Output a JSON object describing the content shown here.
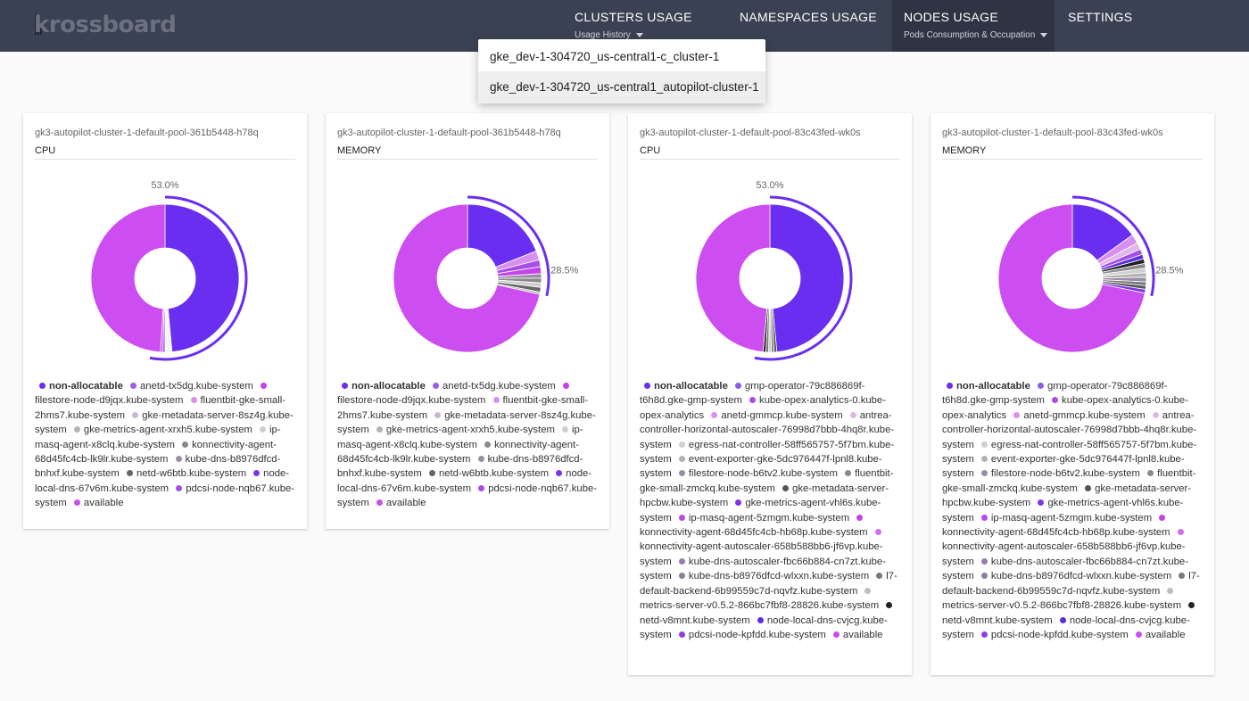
{
  "app": {
    "logo": "krossboard"
  },
  "nav": {
    "clusters": {
      "label": "CLUSTERS USAGE",
      "sub": "Usage History"
    },
    "namespaces": {
      "label": "NAMESPACES USAGE"
    },
    "nodes": {
      "label": "NODES USAGE",
      "sub": "Pods Consumption & Occupation"
    },
    "settings": {
      "label": "SETTINGS"
    }
  },
  "dropdown": {
    "items": [
      "gke_dev-1-304720_us-central1-c_cluster-1",
      "gke_dev-1-304720_us-central1_autopilot-cluster-1"
    ],
    "selected_index": 1
  },
  "colors": {
    "accent": "#6a2ef0",
    "available": "#cc4df0",
    "topbar": "#3a4152"
  },
  "cards": [
    {
      "node": "gk3-autopilot-cluster-1-default-pool-361b5448-h78q",
      "metric": "CPU",
      "usage_label": "53.0%",
      "usage_fraction": 0.53,
      "legend": [
        {
          "label": "non-allocatable",
          "color": "#6a2ef0",
          "bold": true
        },
        {
          "label": "anetd-tx5dg.kube-system",
          "color": "#9b5de5"
        },
        {
          "label": "filestore-node-d9jqx.kube-system",
          "color": "#c542e6"
        },
        {
          "label": "fluentbit-gke-small-2hms7.kube-system",
          "color": "#d88ff0"
        },
        {
          "label": "gke-metadata-server-8sz4g.kube-system",
          "color": "#c9b8d4"
        },
        {
          "label": "gke-metrics-agent-xrxh5.kube-system",
          "color": "#b3b3b3"
        },
        {
          "label": "ip-masq-agent-x8clq.kube-system",
          "color": "#cfcfcf"
        },
        {
          "label": "konnectivity-agent-68d45fc4cb-lk9lr.kube-system",
          "color": "#8a8a8a"
        },
        {
          "label": "kube-dns-b8976dfcd-bnhxf.kube-system",
          "color": "#9a8da6"
        },
        {
          "label": "netd-w6btb.kube-system",
          "color": "#666666"
        },
        {
          "label": "node-local-dns-67v6m.kube-system",
          "color": "#7b36e8"
        },
        {
          "label": "pdcsi-node-nqb67.kube-system",
          "color": "#a64ee8"
        },
        {
          "label": "available",
          "color": "#cc4df0"
        }
      ],
      "slices": [
        {
          "value": 0.485,
          "color": "#6a2ef0"
        },
        {
          "value": 0.015,
          "color": "#f5f5f5"
        },
        {
          "value": 0.005,
          "color": "#9b5de5"
        },
        {
          "value": 0.005,
          "color": "#c542e6"
        },
        {
          "value": 0.49,
          "color": "#cc4df0"
        }
      ]
    },
    {
      "node": "gk3-autopilot-cluster-1-default-pool-361b5448-h78q",
      "metric": "MEMORY",
      "usage_label": "28.5%",
      "usage_fraction": 0.285,
      "legend": [
        {
          "label": "non-allocatable",
          "color": "#6a2ef0",
          "bold": true
        },
        {
          "label": "anetd-tx5dg.kube-system",
          "color": "#9b5de5"
        },
        {
          "label": "filestore-node-d9jqx.kube-system",
          "color": "#c542e6"
        },
        {
          "label": "fluentbit-gke-small-2hms7.kube-system",
          "color": "#d88ff0"
        },
        {
          "label": "gke-metadata-server-8sz4g.kube-system",
          "color": "#c9b8d4"
        },
        {
          "label": "gke-metrics-agent-xrxh5.kube-system",
          "color": "#b3b3b3"
        },
        {
          "label": "ip-masq-agent-x8clq.kube-system",
          "color": "#cfcfcf"
        },
        {
          "label": "konnectivity-agent-68d45fc4cb-lk9lr.kube-system",
          "color": "#8a8a8a"
        },
        {
          "label": "kube-dns-b8976dfcd-bnhxf.kube-system",
          "color": "#9a8da6"
        },
        {
          "label": "netd-w6btb.kube-system",
          "color": "#666666"
        },
        {
          "label": "node-local-dns-67v6m.kube-system",
          "color": "#7b36e8"
        },
        {
          "label": "pdcsi-node-nqb67.kube-system",
          "color": "#a64ee8"
        },
        {
          "label": "available",
          "color": "#cc4df0"
        }
      ],
      "slices": [
        {
          "value": 0.19,
          "color": "#6a2ef0"
        },
        {
          "value": 0.02,
          "color": "#d88ff0"
        },
        {
          "value": 0.015,
          "color": "#a64ee8"
        },
        {
          "value": 0.015,
          "color": "#c542e6"
        },
        {
          "value": 0.01,
          "color": "#9a8da6"
        },
        {
          "value": 0.01,
          "color": "#8a8a8a"
        },
        {
          "value": 0.01,
          "color": "#cfcfcf"
        },
        {
          "value": 0.01,
          "color": "#666666"
        },
        {
          "value": 0.005,
          "color": "#b3b3b3"
        },
        {
          "value": 0.715,
          "color": "#cc4df0"
        }
      ]
    },
    {
      "node": "gk3-autopilot-cluster-1-default-pool-83c43fed-wk0s",
      "metric": "CPU",
      "usage_label": "53.0%",
      "usage_fraction": 0.53,
      "legend": [
        {
          "label": "non-allocatable",
          "color": "#6a2ef0",
          "bold": true
        },
        {
          "label": "gmp-operator-79c886869f-t6h8d.gke-gmp-system",
          "color": "#8a5de8"
        },
        {
          "label": "kube-opex-analytics-0.kube-opex-analytics",
          "color": "#a64ee8"
        },
        {
          "label": "anetd-gmmcp.kube-system",
          "color": "#d88ff0"
        },
        {
          "label": "antrea-controller-horizontal-autoscaler-76998d7bbb-4hq8r.kube-system",
          "color": "#e0b8e8"
        },
        {
          "label": "egress-nat-controller-58ff565757-5f7bm.kube-system",
          "color": "#cfcfcf"
        },
        {
          "label": "event-exporter-gke-5dc976447f-lpnl8.kube-system",
          "color": "#b3b3b3"
        },
        {
          "label": "filestore-node-b6tv2.kube-system",
          "color": "#9a8da6"
        },
        {
          "label": "fluentbit-gke-small-zmckq.kube-system",
          "color": "#8a8a8a"
        },
        {
          "label": "gke-metadata-server-hpcbw.kube-system",
          "color": "#555555"
        },
        {
          "label": "gke-metrics-agent-vhl6s.kube-system",
          "color": "#7b36e8"
        },
        {
          "label": "ip-masq-agent-5zmgm.kube-system",
          "color": "#b24de8"
        },
        {
          "label": "konnectivity-agent-68d45fc4cb-hb68p.kube-system",
          "color": "#c542e6"
        },
        {
          "label": "konnectivity-agent-autoscaler-658b588bb6-jf6vp.kube-system",
          "color": "#d070e8"
        },
        {
          "label": "kube-dns-autoscaler-fbc66b884-cn7zt.kube-system",
          "color": "#9b7ab0"
        },
        {
          "label": "kube-dns-b8976dfcd-wlxxn.kube-system",
          "color": "#8d7f99"
        },
        {
          "label": "l7-default-backend-6b99559c7d-nqvfz.kube-system",
          "color": "#777777"
        },
        {
          "label": "metrics-server-v0.5.2-866bc7fbf8-28826.kube-system",
          "color": "#bdbdbd"
        },
        {
          "label": "netd-v8mnt.kube-system",
          "color": "#222222"
        },
        {
          "label": "node-local-dns-cvjcg.kube-system",
          "color": "#5a2ee0"
        },
        {
          "label": "pdcsi-node-kpfdd.kube-system",
          "color": "#8e3ee8"
        },
        {
          "label": "available",
          "color": "#cc4df0"
        }
      ],
      "slices": [
        {
          "value": 0.485,
          "color": "#6a2ef0"
        },
        {
          "value": 0.006,
          "color": "#555555"
        },
        {
          "value": 0.006,
          "color": "#8a8a8a"
        },
        {
          "value": 0.006,
          "color": "#cfcfcf"
        },
        {
          "value": 0.006,
          "color": "#777777"
        },
        {
          "value": 0.006,
          "color": "#222222"
        },
        {
          "value": 0.485,
          "color": "#cc4df0"
        }
      ]
    },
    {
      "node": "gk3-autopilot-cluster-1-default-pool-83c43fed-wk0s",
      "metric": "MEMORY",
      "usage_label": "28.5%",
      "usage_fraction": 0.285,
      "legend": [
        {
          "label": "non-allocatable",
          "color": "#6a2ef0",
          "bold": true
        },
        {
          "label": "gmp-operator-79c886869f-t6h8d.gke-gmp-system",
          "color": "#8a5de8"
        },
        {
          "label": "kube-opex-analytics-0.kube-opex-analytics",
          "color": "#a64ee8"
        },
        {
          "label": "anetd-gmmcp.kube-system",
          "color": "#d88ff0"
        },
        {
          "label": "antrea-controller-horizontal-autoscaler-76998d7bbb-4hq8r.kube-system",
          "color": "#e0b8e8"
        },
        {
          "label": "egress-nat-controller-58ff565757-5f7bm.kube-system",
          "color": "#cfcfcf"
        },
        {
          "label": "event-exporter-gke-5dc976447f-lpnl8.kube-system",
          "color": "#b3b3b3"
        },
        {
          "label": "filestore-node-b6tv2.kube-system",
          "color": "#9a8da6"
        },
        {
          "label": "fluentbit-gke-small-zmckq.kube-system",
          "color": "#8a8a8a"
        },
        {
          "label": "gke-metadata-server-hpcbw.kube-system",
          "color": "#555555"
        },
        {
          "label": "gke-metrics-agent-vhl6s.kube-system",
          "color": "#7b36e8"
        },
        {
          "label": "ip-masq-agent-5zmgm.kube-system",
          "color": "#b24de8"
        },
        {
          "label": "konnectivity-agent-68d45fc4cb-hb68p.kube-system",
          "color": "#c542e6"
        },
        {
          "label": "konnectivity-agent-autoscaler-658b588bb6-jf6vp.kube-system",
          "color": "#d070e8"
        },
        {
          "label": "kube-dns-autoscaler-fbc66b884-cn7zt.kube-system",
          "color": "#9b7ab0"
        },
        {
          "label": "kube-dns-b8976dfcd-wlxxn.kube-system",
          "color": "#8d7f99"
        },
        {
          "label": "l7-default-backend-6b99559c7d-nqvfz.kube-system",
          "color": "#777777"
        },
        {
          "label": "metrics-server-v0.5.2-866bc7fbf8-28826.kube-system",
          "color": "#bdbdbd"
        },
        {
          "label": "netd-v8mnt.kube-system",
          "color": "#222222"
        },
        {
          "label": "node-local-dns-cvjcg.kube-system",
          "color": "#5a2ee0"
        },
        {
          "label": "pdcsi-node-kpfdd.kube-system",
          "color": "#8e3ee8"
        },
        {
          "label": "available",
          "color": "#cc4df0"
        }
      ],
      "slices": [
        {
          "value": 0.15,
          "color": "#6a2ef0"
        },
        {
          "value": 0.02,
          "color": "#d88ff0"
        },
        {
          "value": 0.015,
          "color": "#e0b8e8"
        },
        {
          "value": 0.012,
          "color": "#a64ee8"
        },
        {
          "value": 0.01,
          "color": "#5a2ee0"
        },
        {
          "value": 0.01,
          "color": "#222222"
        },
        {
          "value": 0.01,
          "color": "#8a8a8a"
        },
        {
          "value": 0.01,
          "color": "#cfcfcf"
        },
        {
          "value": 0.01,
          "color": "#b3b3b3"
        },
        {
          "value": 0.01,
          "color": "#9a8da6"
        },
        {
          "value": 0.008,
          "color": "#777777"
        },
        {
          "value": 0.008,
          "color": "#555555"
        },
        {
          "value": 0.008,
          "color": "#7b36e8"
        },
        {
          "value": 0.715,
          "color": "#cc4df0"
        }
      ]
    }
  ]
}
